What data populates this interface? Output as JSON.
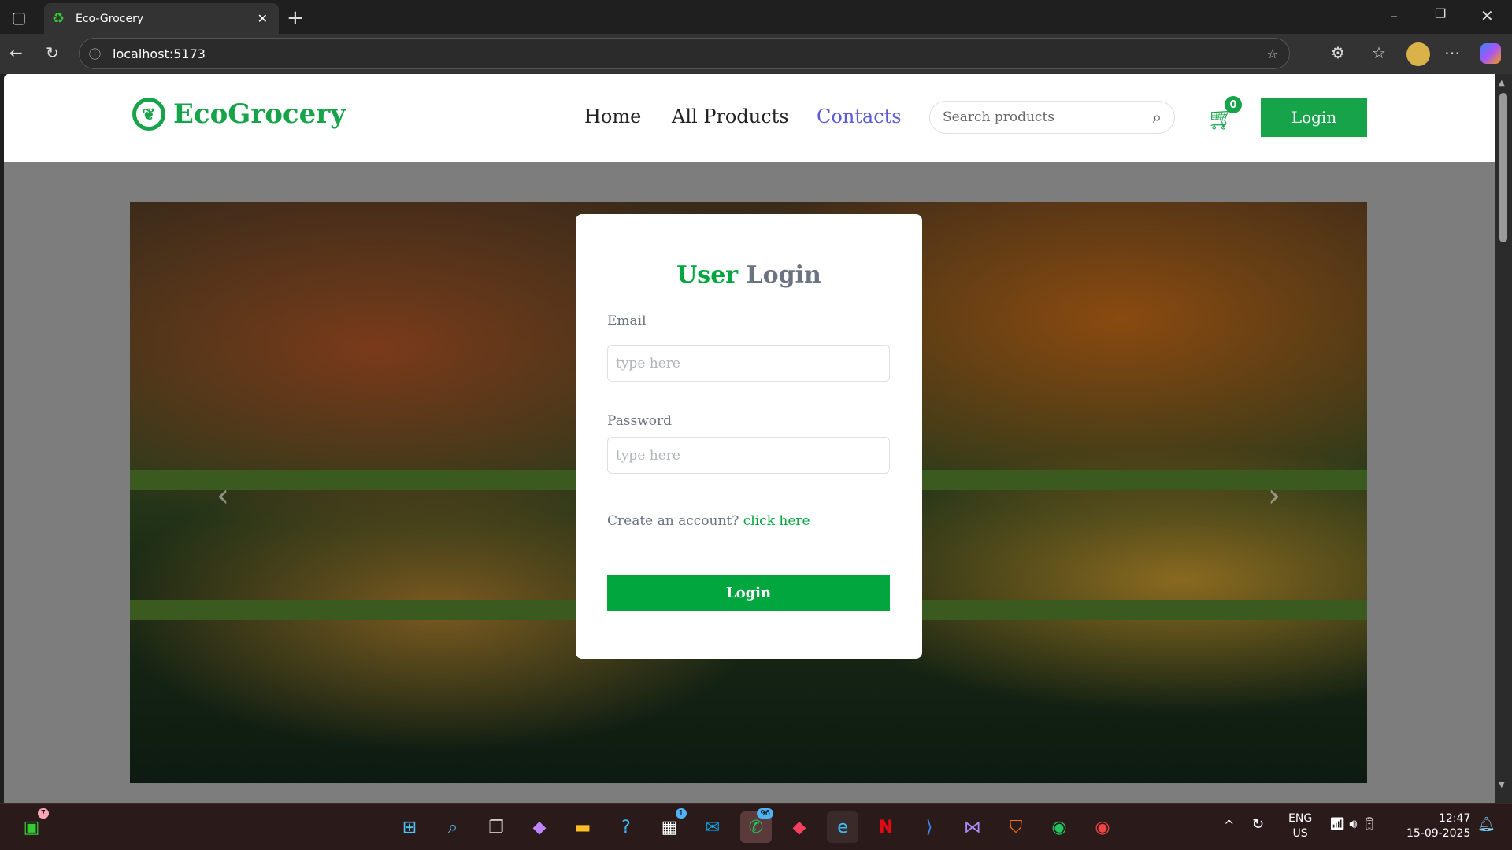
{
  "browser": {
    "tab_title": "Eco-Grocery",
    "url": "localhost:5173"
  },
  "header": {
    "logo": "EcoGrocery",
    "nav": [
      {
        "label": "Home"
      },
      {
        "label": "All Products"
      },
      {
        "label": "Contacts",
        "active": true
      }
    ],
    "search_placeholder": "Search products",
    "cart_count": "0",
    "login_label": "Login"
  },
  "login": {
    "title_accent": "User",
    "title_rest": "Login",
    "email_label": "Email",
    "email_placeholder": "type here",
    "password_label": "Password",
    "password_placeholder": "type here",
    "create_text": "Create an account?",
    "create_link": "click here",
    "submit_label": "Login"
  },
  "taskbar": {
    "store_badge": "7",
    "outlook_badge": "1",
    "whatsapp_badge": "96",
    "lang": "ENG",
    "region": "US",
    "time": "12:47",
    "date": "15-09-2025"
  },
  "colors": {
    "brand": "#16a34a",
    "nav_active": "#5b5bd6",
    "text_gray": "#6b7280"
  }
}
